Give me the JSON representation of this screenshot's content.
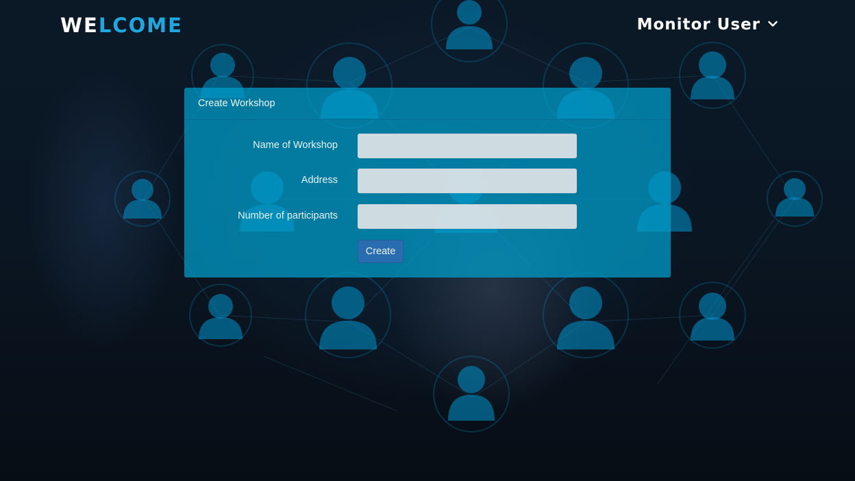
{
  "header": {
    "logo_part1": "WE",
    "logo_part2": "LCOME",
    "user_menu_label": "Monitor User"
  },
  "form": {
    "title": "Create Workshop",
    "fields": [
      {
        "label": "Name of Workshop",
        "value": "",
        "placeholder": ""
      },
      {
        "label": "Address",
        "value": "",
        "placeholder": ""
      },
      {
        "label": "Number of participants",
        "value": "",
        "placeholder": ""
      }
    ],
    "submit_label": "Create"
  },
  "colors": {
    "logo_white": "#ffffff",
    "logo_accent": "#1da8e0",
    "panel": "#00a0cd",
    "button": "#2a6cb0"
  },
  "icons": {
    "user_menu": "chevron-down-icon",
    "background": "user-network-icon"
  }
}
